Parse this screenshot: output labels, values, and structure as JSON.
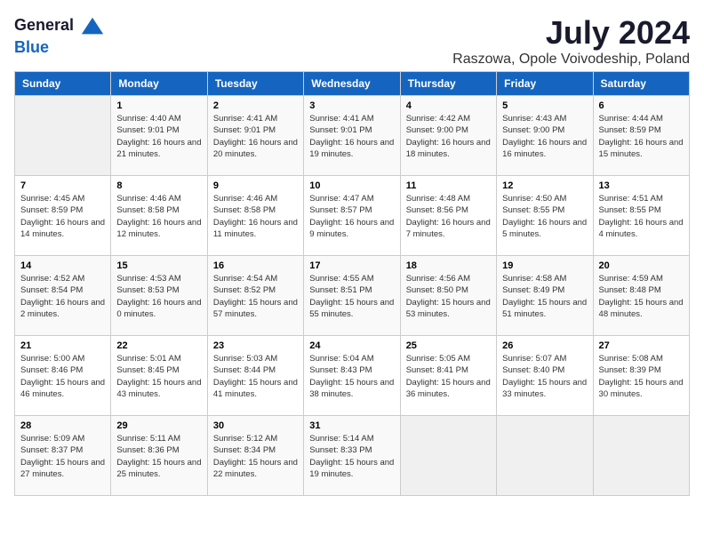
{
  "logo": {
    "general": "General",
    "blue": "Blue"
  },
  "title": "July 2024",
  "location": "Raszowa, Opole Voivodeship, Poland",
  "days_of_week": [
    "Sunday",
    "Monday",
    "Tuesday",
    "Wednesday",
    "Thursday",
    "Friday",
    "Saturday"
  ],
  "rows": [
    [
      {
        "day": "",
        "sunrise": "",
        "sunset": "",
        "daylight": ""
      },
      {
        "day": "1",
        "sunrise": "Sunrise: 4:40 AM",
        "sunset": "Sunset: 9:01 PM",
        "daylight": "Daylight: 16 hours and 21 minutes."
      },
      {
        "day": "2",
        "sunrise": "Sunrise: 4:41 AM",
        "sunset": "Sunset: 9:01 PM",
        "daylight": "Daylight: 16 hours and 20 minutes."
      },
      {
        "day": "3",
        "sunrise": "Sunrise: 4:41 AM",
        "sunset": "Sunset: 9:01 PM",
        "daylight": "Daylight: 16 hours and 19 minutes."
      },
      {
        "day": "4",
        "sunrise": "Sunrise: 4:42 AM",
        "sunset": "Sunset: 9:00 PM",
        "daylight": "Daylight: 16 hours and 18 minutes."
      },
      {
        "day": "5",
        "sunrise": "Sunrise: 4:43 AM",
        "sunset": "Sunset: 9:00 PM",
        "daylight": "Daylight: 16 hours and 16 minutes."
      },
      {
        "day": "6",
        "sunrise": "Sunrise: 4:44 AM",
        "sunset": "Sunset: 8:59 PM",
        "daylight": "Daylight: 16 hours and 15 minutes."
      }
    ],
    [
      {
        "day": "7",
        "sunrise": "Sunrise: 4:45 AM",
        "sunset": "Sunset: 8:59 PM",
        "daylight": "Daylight: 16 hours and 14 minutes."
      },
      {
        "day": "8",
        "sunrise": "Sunrise: 4:46 AM",
        "sunset": "Sunset: 8:58 PM",
        "daylight": "Daylight: 16 hours and 12 minutes."
      },
      {
        "day": "9",
        "sunrise": "Sunrise: 4:46 AM",
        "sunset": "Sunset: 8:58 PM",
        "daylight": "Daylight: 16 hours and 11 minutes."
      },
      {
        "day": "10",
        "sunrise": "Sunrise: 4:47 AM",
        "sunset": "Sunset: 8:57 PM",
        "daylight": "Daylight: 16 hours and 9 minutes."
      },
      {
        "day": "11",
        "sunrise": "Sunrise: 4:48 AM",
        "sunset": "Sunset: 8:56 PM",
        "daylight": "Daylight: 16 hours and 7 minutes."
      },
      {
        "day": "12",
        "sunrise": "Sunrise: 4:50 AM",
        "sunset": "Sunset: 8:55 PM",
        "daylight": "Daylight: 16 hours and 5 minutes."
      },
      {
        "day": "13",
        "sunrise": "Sunrise: 4:51 AM",
        "sunset": "Sunset: 8:55 PM",
        "daylight": "Daylight: 16 hours and 4 minutes."
      }
    ],
    [
      {
        "day": "14",
        "sunrise": "Sunrise: 4:52 AM",
        "sunset": "Sunset: 8:54 PM",
        "daylight": "Daylight: 16 hours and 2 minutes."
      },
      {
        "day": "15",
        "sunrise": "Sunrise: 4:53 AM",
        "sunset": "Sunset: 8:53 PM",
        "daylight": "Daylight: 16 hours and 0 minutes."
      },
      {
        "day": "16",
        "sunrise": "Sunrise: 4:54 AM",
        "sunset": "Sunset: 8:52 PM",
        "daylight": "Daylight: 15 hours and 57 minutes."
      },
      {
        "day": "17",
        "sunrise": "Sunrise: 4:55 AM",
        "sunset": "Sunset: 8:51 PM",
        "daylight": "Daylight: 15 hours and 55 minutes."
      },
      {
        "day": "18",
        "sunrise": "Sunrise: 4:56 AM",
        "sunset": "Sunset: 8:50 PM",
        "daylight": "Daylight: 15 hours and 53 minutes."
      },
      {
        "day": "19",
        "sunrise": "Sunrise: 4:58 AM",
        "sunset": "Sunset: 8:49 PM",
        "daylight": "Daylight: 15 hours and 51 minutes."
      },
      {
        "day": "20",
        "sunrise": "Sunrise: 4:59 AM",
        "sunset": "Sunset: 8:48 PM",
        "daylight": "Daylight: 15 hours and 48 minutes."
      }
    ],
    [
      {
        "day": "21",
        "sunrise": "Sunrise: 5:00 AM",
        "sunset": "Sunset: 8:46 PM",
        "daylight": "Daylight: 15 hours and 46 minutes."
      },
      {
        "day": "22",
        "sunrise": "Sunrise: 5:01 AM",
        "sunset": "Sunset: 8:45 PM",
        "daylight": "Daylight: 15 hours and 43 minutes."
      },
      {
        "day": "23",
        "sunrise": "Sunrise: 5:03 AM",
        "sunset": "Sunset: 8:44 PM",
        "daylight": "Daylight: 15 hours and 41 minutes."
      },
      {
        "day": "24",
        "sunrise": "Sunrise: 5:04 AM",
        "sunset": "Sunset: 8:43 PM",
        "daylight": "Daylight: 15 hours and 38 minutes."
      },
      {
        "day": "25",
        "sunrise": "Sunrise: 5:05 AM",
        "sunset": "Sunset: 8:41 PM",
        "daylight": "Daylight: 15 hours and 36 minutes."
      },
      {
        "day": "26",
        "sunrise": "Sunrise: 5:07 AM",
        "sunset": "Sunset: 8:40 PM",
        "daylight": "Daylight: 15 hours and 33 minutes."
      },
      {
        "day": "27",
        "sunrise": "Sunrise: 5:08 AM",
        "sunset": "Sunset: 8:39 PM",
        "daylight": "Daylight: 15 hours and 30 minutes."
      }
    ],
    [
      {
        "day": "28",
        "sunrise": "Sunrise: 5:09 AM",
        "sunset": "Sunset: 8:37 PM",
        "daylight": "Daylight: 15 hours and 27 minutes."
      },
      {
        "day": "29",
        "sunrise": "Sunrise: 5:11 AM",
        "sunset": "Sunset: 8:36 PM",
        "daylight": "Daylight: 15 hours and 25 minutes."
      },
      {
        "day": "30",
        "sunrise": "Sunrise: 5:12 AM",
        "sunset": "Sunset: 8:34 PM",
        "daylight": "Daylight: 15 hours and 22 minutes."
      },
      {
        "day": "31",
        "sunrise": "Sunrise: 5:14 AM",
        "sunset": "Sunset: 8:33 PM",
        "daylight": "Daylight: 15 hours and 19 minutes."
      },
      {
        "day": "",
        "sunrise": "",
        "sunset": "",
        "daylight": ""
      },
      {
        "day": "",
        "sunrise": "",
        "sunset": "",
        "daylight": ""
      },
      {
        "day": "",
        "sunrise": "",
        "sunset": "",
        "daylight": ""
      }
    ]
  ]
}
